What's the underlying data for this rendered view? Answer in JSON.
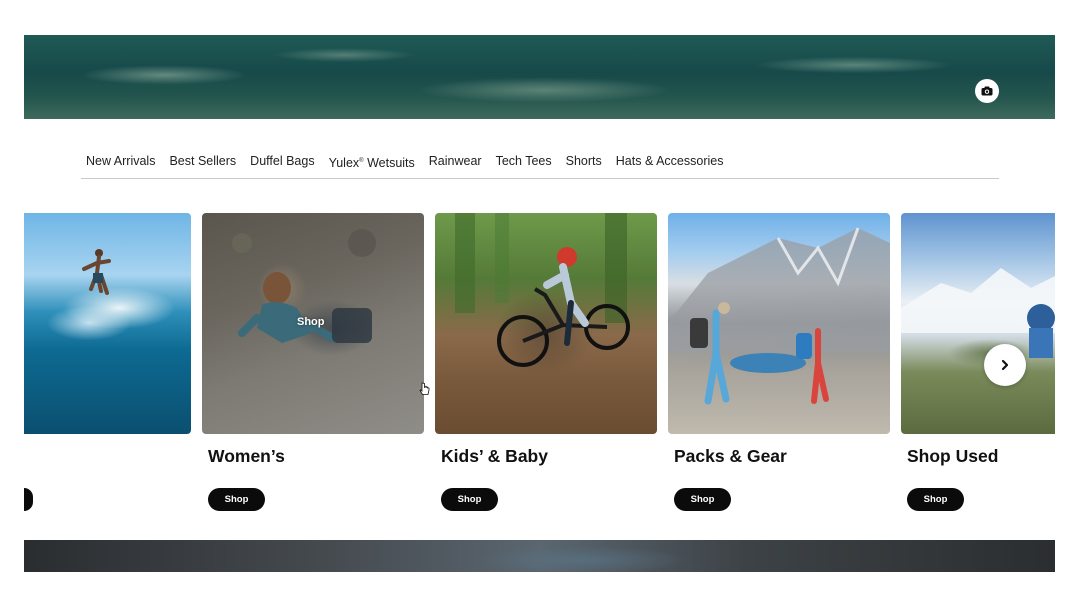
{
  "hero": {
    "icon": "camera-icon"
  },
  "nav": {
    "items": [
      {
        "label": "New Arrivals"
      },
      {
        "label": "Best Sellers"
      },
      {
        "label": "Duffel Bags"
      },
      {
        "label": "Yulex",
        "sup": "®",
        "suffix": " Wetsuits"
      },
      {
        "label": "Rainwear"
      },
      {
        "label": "Tech Tees"
      },
      {
        "label": "Shorts"
      },
      {
        "label": "Hats & Accessories"
      }
    ]
  },
  "carousel": {
    "hover_shop_label": "Shop",
    "cards": [
      {
        "title": "",
        "button": ""
      },
      {
        "title": "Women’s",
        "button": "Shop"
      },
      {
        "title": "Kids’ & Baby",
        "button": "Shop"
      },
      {
        "title": "Packs & Gear",
        "button": "Shop"
      },
      {
        "title": "Shop Used",
        "button": "Shop"
      }
    ],
    "next_icon": "chevron-right-icon",
    "cursor_icon": "pointer-cursor-icon"
  }
}
